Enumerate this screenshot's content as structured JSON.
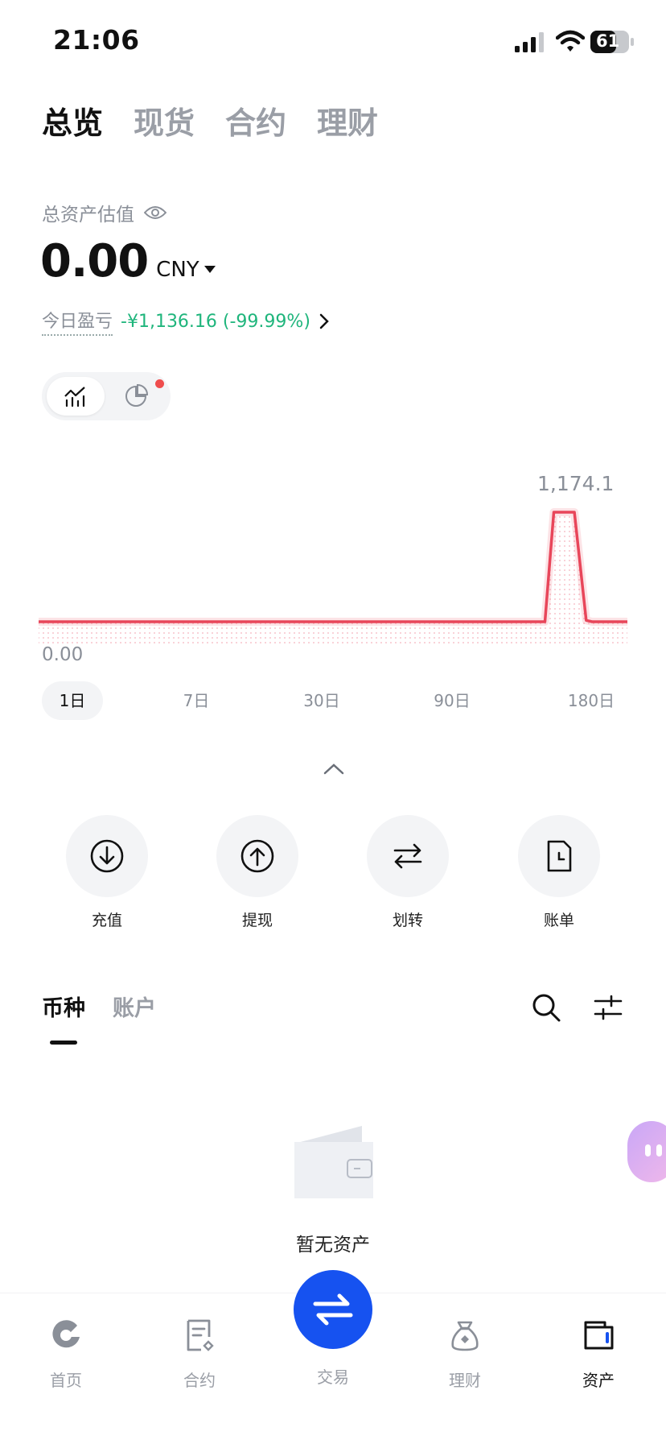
{
  "status_bar": {
    "time": "21:06",
    "battery": "61"
  },
  "top_tabs": [
    {
      "label": "总览",
      "active": true
    },
    {
      "label": "现货",
      "active": false
    },
    {
      "label": "合约",
      "active": false
    },
    {
      "label": "理财",
      "active": false
    }
  ],
  "overview": {
    "total_label": "总资产估值",
    "total_value": "0.00",
    "currency": "CNY",
    "pnl_label": "今日盈亏",
    "pnl_value": "-¥1,136.16 (-99.99%)"
  },
  "chart_data": {
    "type": "area",
    "max_label": "1,174.1",
    "min_label": "0.00",
    "x": [
      0,
      0.86,
      0.875,
      0.885,
      0.9,
      0.91,
      0.93,
      0.94,
      1.0
    ],
    "y": [
      0,
      0,
      1174.1,
      1174.1,
      1174.1,
      1174.1,
      15,
      0,
      0
    ],
    "ylim": [
      0,
      1174.1
    ],
    "line_color": "#e8465a"
  },
  "ranges": [
    "1日",
    "7日",
    "30日",
    "90日",
    "180日"
  ],
  "active_range": "1日",
  "actions": [
    "充值",
    "提现",
    "划转",
    "账单"
  ],
  "asset_tabs": [
    "币种",
    "账户"
  ],
  "empty_text": "暂无资产",
  "nav": {
    "home": "首页",
    "contract": "合约",
    "trade": "交易",
    "finance": "理财",
    "assets": "资产"
  },
  "colors": {
    "accent": "#1652f0",
    "profit_green": "#1fb57c",
    "chart_red": "#e8465a"
  }
}
